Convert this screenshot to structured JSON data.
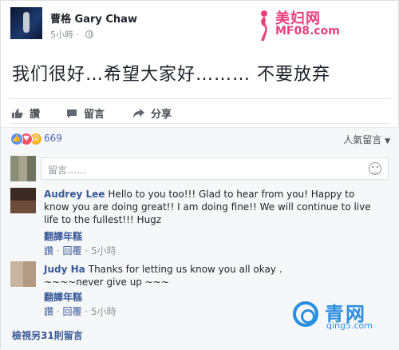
{
  "post": {
    "author": "曹格 Gary Chaw",
    "time": "5小時",
    "text": "我们很好…希望大家好……… 不要放弃"
  },
  "watermark": {
    "brand": "美妇网",
    "url": "MF08.com"
  },
  "actions": {
    "like": "讚",
    "comment": "留言",
    "share": "分享"
  },
  "reactions": {
    "count": "669",
    "sort_label": "人氣留言"
  },
  "comment_input": {
    "placeholder": "留言……"
  },
  "comments": [
    {
      "name": "Audrey Lee",
      "text": "Hello to you too!!! Glad to hear from you! Happy to know you are doing great!! I am doing fine!! We will continue to live life to the fullest!!! Hugz",
      "translate": "翻譯年糕",
      "like": "讚",
      "reply": "回覆",
      "time": "5小時"
    },
    {
      "name": "Judy Ha",
      "text_line1": "Thanks for letting us know you all okay .",
      "text_line2": "~~~~never give up ~~~",
      "translate": "翻譯年糕",
      "like": "讚",
      "reply": "回覆",
      "time": "5小時"
    }
  ],
  "more_comments": "檢視另31則留言",
  "qing_watermark": {
    "brand": "青网",
    "url": "qing5.com"
  },
  "colors": {
    "link": "#365899",
    "like_blue": "#5890ff",
    "love_red": "#f25268",
    "wow_yellow": "#f7b125",
    "watermark_pink": "#e9407d",
    "qing_blue": "#2a8ee0"
  }
}
